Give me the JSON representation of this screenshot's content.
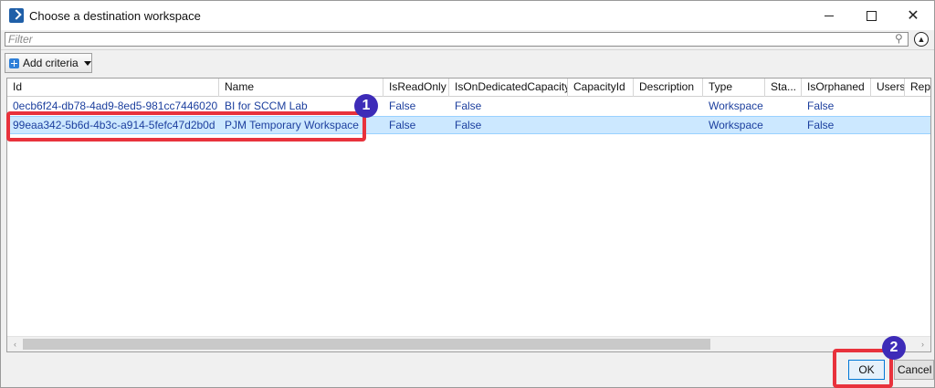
{
  "window": {
    "title": "Choose a destination workspace",
    "close_glyph": "✕"
  },
  "filter": {
    "placeholder": "Filter",
    "search_glyph": "⚲",
    "collapse_glyph": "▲"
  },
  "toolbar": {
    "add_criteria_label": "Add criteria"
  },
  "grid": {
    "columns": [
      "Id",
      "Name",
      "IsReadOnly",
      "IsOnDedicatedCapacity",
      "CapacityId",
      "Description",
      "Type",
      "Sta...",
      "IsOrphaned",
      "Users",
      "Rep"
    ],
    "rows": [
      {
        "id": "0ecb6f24-db78-4ad9-8ed5-981cc7446020",
        "name": "BI for SCCM Lab",
        "is_read_only": "False",
        "is_on_dedicated_capacity": "False",
        "capacity_id": "",
        "description": "",
        "type": "Workspace",
        "state": "",
        "is_orphaned": "False",
        "users": "",
        "rep": ""
      },
      {
        "id": "99eaa342-5b6d-4b3c-a914-5fefc47d2b0d",
        "name": "PJM Temporary Workspace",
        "is_read_only": "False",
        "is_on_dedicated_capacity": "False",
        "capacity_id": "",
        "description": "",
        "type": "Workspace",
        "state": "",
        "is_orphaned": "False",
        "users": "",
        "rep": "",
        "selected": true
      }
    ]
  },
  "scrollbar": {
    "left_glyph": "‹",
    "right_glyph": "›"
  },
  "footer": {
    "ok_label": "OK",
    "cancel_label": "Cancel"
  },
  "annotations": {
    "badge_1": "1",
    "badge_2": "2",
    "highlight_color": "#e8323c",
    "badge_color": "#3d2bb8"
  },
  "colors": {
    "selected_row": "#cce8ff",
    "link_text": "#1c3f9e",
    "accent": "#0078d7"
  }
}
